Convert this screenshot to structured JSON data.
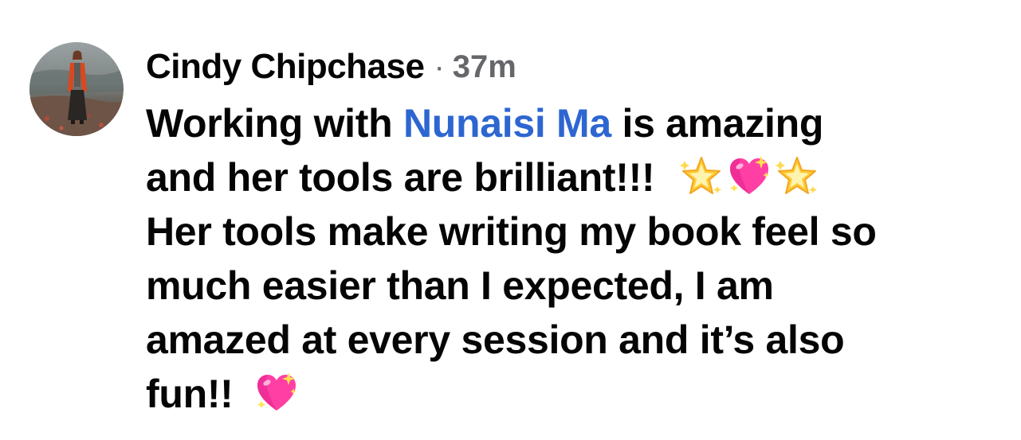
{
  "comment": {
    "author": "Cindy Chipchase",
    "separator": "·",
    "timestamp": "37m",
    "avatar_icon": "profile-photo-avatar",
    "lines": {
      "l1_before": "Working with ",
      "l1_mention": "Nunaisi Ma",
      "l1_after": " is amazing",
      "l2": "and her tools are brilliant!!!",
      "l3": "Her tools make writing my book feel so",
      "l4": "much easier than I expected, I am",
      "l5": "amazed at every session and it’s also",
      "l6": "fun!!"
    },
    "emojis": [
      "glowing-star-icon",
      "sparkling-heart-icon",
      "glowing-star-icon",
      "sparkling-heart-icon"
    ],
    "colors": {
      "text": "#050505",
      "secondary": "#65676b",
      "mention": "#2e66d1",
      "heart": "#ff3fa4",
      "star": "#ffcc33"
    }
  }
}
